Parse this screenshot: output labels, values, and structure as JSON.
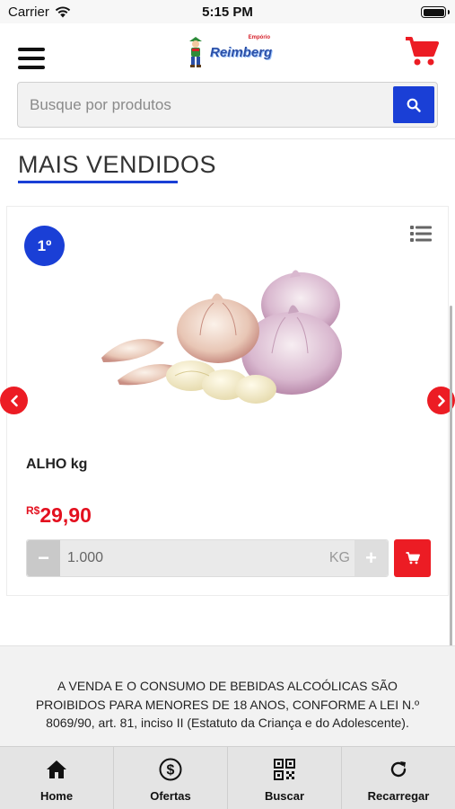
{
  "status_bar": {
    "carrier": "Carrier",
    "time": "5:15 PM"
  },
  "header": {
    "logo_text": "Reimberg",
    "logo_sub": "Empório",
    "cart_icon": "cart-icon",
    "menu_icon": "hamburger-icon"
  },
  "search": {
    "placeholder": "Busque por produtos",
    "button_icon": "search-icon"
  },
  "section": {
    "title": "MAIS VENDIDOS"
  },
  "product": {
    "rank": "1º",
    "name": "ALHO kg",
    "currency": "R$",
    "price": "29,90",
    "quantity": "1.000",
    "unit": "KG",
    "minus_label": "−",
    "plus_label": "+"
  },
  "notice": {
    "text": "A VENDA E O CONSUMO DE BEBIDAS ALCOÓLICAS SÃO PROIBIDOS PARA MENORES DE 18 ANOS, CONFORME A LEI N.º 8069/90, art. 81, inciso II (Estatuto da Criança e do Adolescente)."
  },
  "tabbar": {
    "items": [
      {
        "label": "Home",
        "icon": "home-icon"
      },
      {
        "label": "Ofertas",
        "icon": "dollar-icon"
      },
      {
        "label": "Buscar",
        "icon": "qr-code-icon"
      },
      {
        "label": "Recarregar",
        "icon": "reload-icon"
      }
    ]
  },
  "colors": {
    "primary_blue": "#1a3fd6",
    "accent_red": "#ec1c24",
    "price_red": "#e3101f"
  }
}
